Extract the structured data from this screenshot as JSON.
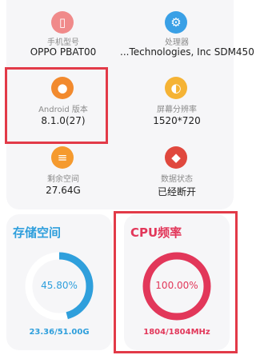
{
  "device_info": {
    "items": [
      {
        "label": "手机型号",
        "value": "OPPO PBAT00",
        "icon": "phone-icon",
        "color": "#f08a8a"
      },
      {
        "label": "处理器",
        "value": "...Technologies, Inc SDM450",
        "icon": "processor-icon",
        "color": "#3aa0e6"
      },
      {
        "label": "Android 版本",
        "value": "8.1.0(27)",
        "icon": "android-icon",
        "color": "#f28a2e"
      },
      {
        "label": "屏幕分辨率",
        "value": "1520*720",
        "icon": "resolution-icon",
        "color": "#f5b335"
      },
      {
        "label": "剩余空间",
        "value": "27.64G",
        "icon": "storage-icon",
        "color": "#f59a2e"
      },
      {
        "label": "数据状态",
        "value": "已经断开",
        "icon": "data-status-icon",
        "color": "#e0483e"
      }
    ]
  },
  "storage_panel": {
    "title": "存储空间",
    "percent": "45.80%",
    "percent_value": 45.8,
    "usage": "23.36/51.00G",
    "color": "#2f9fdc"
  },
  "cpu_panel": {
    "title": "CPU频率",
    "percent": "100.00%",
    "percent_value": 100,
    "frequency": "1804/1804MHz",
    "color": "#e2375a"
  }
}
